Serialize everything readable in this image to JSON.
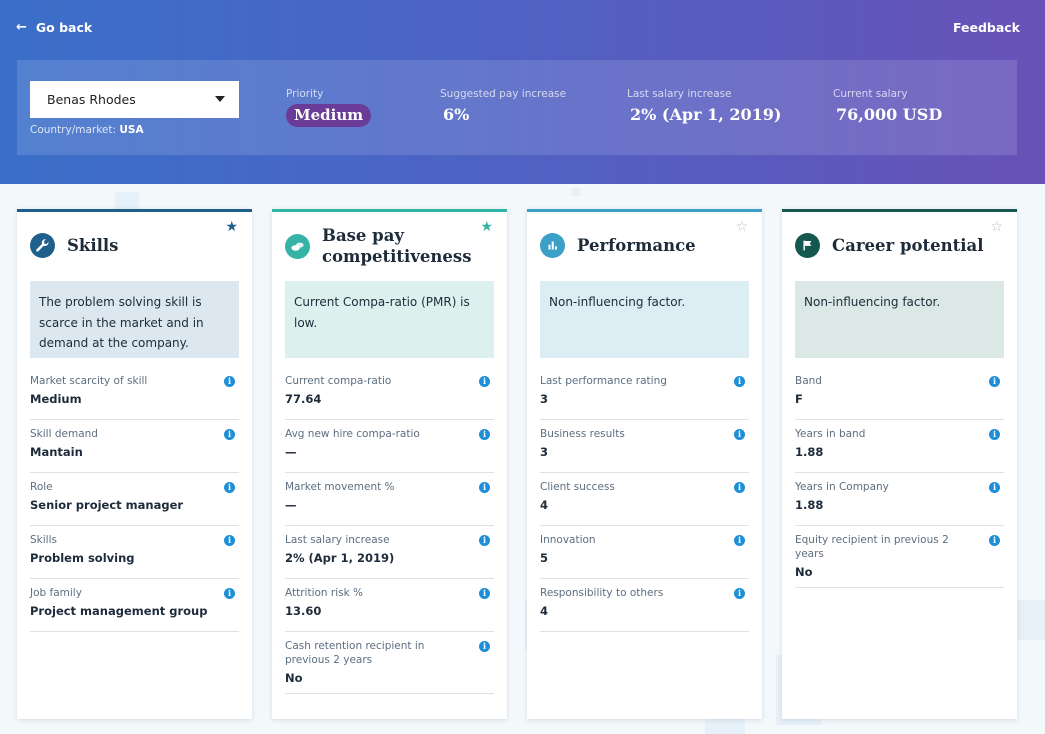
{
  "topbar": {
    "go_back": "Go back",
    "feedback": "Feedback"
  },
  "summary": {
    "employee": "Benas Rhodes",
    "country_label": "Country/market:",
    "country_value": "USA",
    "priority_label": "Priority",
    "priority_value": "Medium",
    "suggested_label": "Suggested pay increase",
    "suggested_value": "6%",
    "last_increase_label": "Last salary increase",
    "last_increase_value": "2% (Apr 1, 2019)",
    "current_salary_label": "Current salary",
    "current_salary_value": "76,000 USD"
  },
  "colors": {
    "skills_accent": "#1f5f8b",
    "basepay_accent": "#35b3a5",
    "performance_accent": "#3aa0c8",
    "career_accent": "#14584f",
    "info": "#1e8fd6",
    "priority_pill": "#6a3c97"
  },
  "cards": [
    {
      "title": "Skills",
      "icon": "wrench-icon",
      "starred": true,
      "description": "The problem solving skill is scarce in the market and in demand at the company.",
      "factors": [
        {
          "label": "Market scarcity of skill",
          "value": "Medium"
        },
        {
          "label": "Skill demand",
          "value": "Mantain"
        },
        {
          "label": "Role",
          "value": "Senior project manager"
        },
        {
          "label": "Skills",
          "value": "Problem solving"
        },
        {
          "label": "Job family",
          "value": "Project management group"
        }
      ]
    },
    {
      "title": "Base pay competitiveness",
      "icon": "coins-icon",
      "starred": true,
      "description": "Current Compa-ratio (PMR) is low.",
      "factors": [
        {
          "label": "Current compa-ratio",
          "value": "77.64"
        },
        {
          "label": "Avg new hire compa-ratio",
          "value": "—"
        },
        {
          "label": "Market movement %",
          "value": "—"
        },
        {
          "label": "Last salary increase",
          "value": "2% (Apr 1, 2019)"
        },
        {
          "label": "Attrition risk %",
          "value": "13.60"
        },
        {
          "label": "Cash retention recipient in previous 2 years",
          "value": "No"
        }
      ]
    },
    {
      "title": "Performance",
      "icon": "bar-chart-icon",
      "starred": false,
      "description": "Non-influencing factor.",
      "factors": [
        {
          "label": "Last performance rating",
          "value": "3"
        },
        {
          "label": "Business results",
          "value": "3"
        },
        {
          "label": "Client success",
          "value": "4"
        },
        {
          "label": "Innovation",
          "value": "5"
        },
        {
          "label": "Responsibility to others",
          "value": "4"
        }
      ]
    },
    {
      "title": "Career potential",
      "icon": "flag-icon",
      "starred": false,
      "description": "Non-influencing factor.",
      "factors": [
        {
          "label": "Band",
          "value": "F"
        },
        {
          "label": "Years in band",
          "value": "1.88"
        },
        {
          "label": "Years in Company",
          "value": "1.88"
        },
        {
          "label": "Equity recipient in previous 2 years",
          "value": "No"
        }
      ]
    }
  ]
}
